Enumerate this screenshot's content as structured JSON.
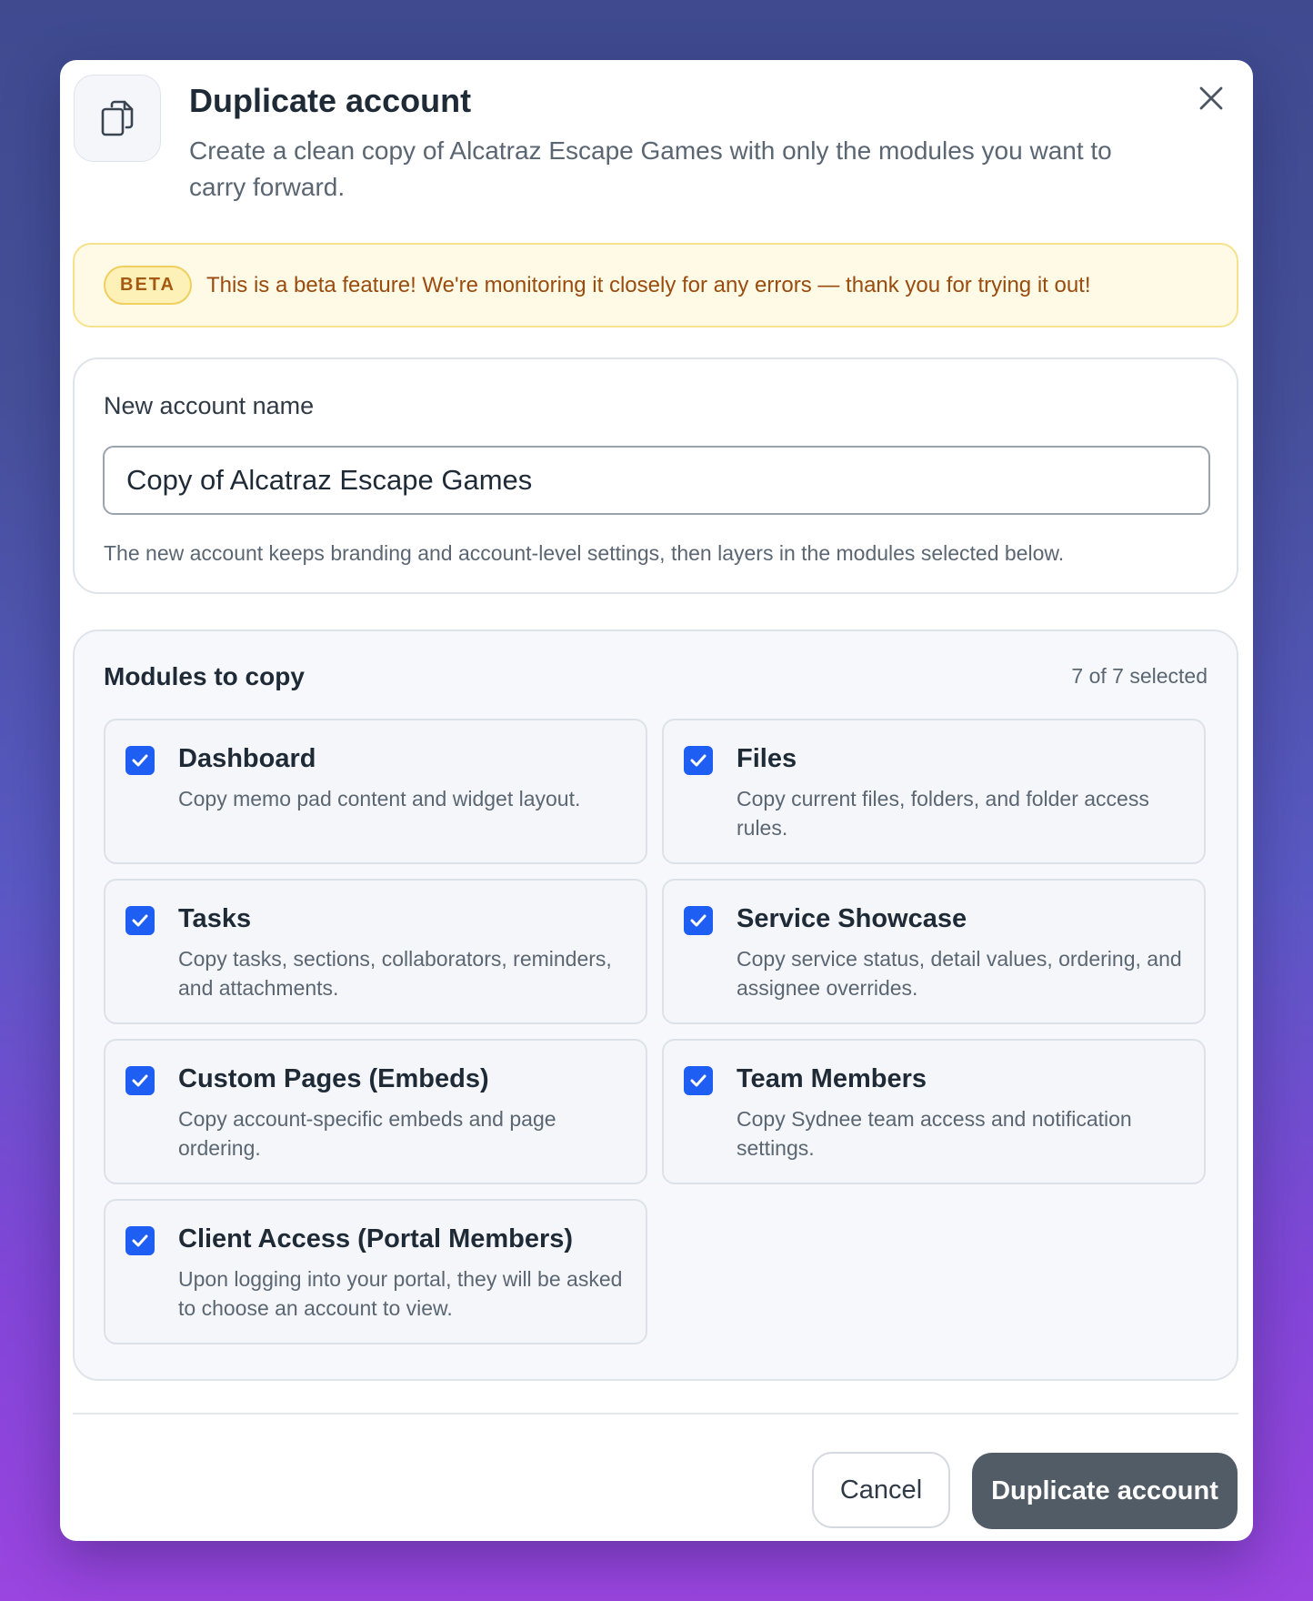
{
  "dialog": {
    "title": "Duplicate account",
    "subtitle": "Create a clean copy of Alcatraz Escape Games with only the modules you want to carry forward."
  },
  "beta": {
    "badge": "BETA",
    "message": "This is a beta feature! We're monitoring it closely for any errors — thank you for trying it out!"
  },
  "name_section": {
    "label": "New account name",
    "value": "Copy of Alcatraz Escape Games",
    "help": "The new account keeps branding and account-level settings, then layers in the modules selected below."
  },
  "modules": {
    "title": "Modules to copy",
    "count": "7 of 7 selected",
    "items": [
      {
        "title": "Dashboard",
        "desc": "Copy memo pad content and widget layout.",
        "checked": true
      },
      {
        "title": "Files",
        "desc": "Copy current files, folders, and folder access rules.",
        "checked": true
      },
      {
        "title": "Tasks",
        "desc": "Copy tasks, sections, collaborators, reminders, and attachments.",
        "checked": true
      },
      {
        "title": "Service Showcase",
        "desc": "Copy service status, detail values, ordering, and assignee overrides.",
        "checked": true
      },
      {
        "title": "Custom Pages (Embeds)",
        "desc": "Copy account-specific embeds and page ordering.",
        "checked": true
      },
      {
        "title": "Team Members",
        "desc": "Copy Sydnee team access and notification settings.",
        "checked": true
      },
      {
        "title": "Client Access (Portal Members)",
        "desc": "Upon logging into your portal, they will be asked to choose an account to view.",
        "checked": true
      }
    ]
  },
  "footer": {
    "cancel_label": "Cancel",
    "submit_label": "Duplicate account"
  },
  "colors": {
    "accent": "#1f5ef3",
    "primary_button": "#525c67",
    "beta_background": "#fefae6",
    "beta_text": "#9a4b0e"
  },
  "icons": {
    "header": "copy-icon",
    "close": "close-icon",
    "checkbox": "checkmark-icon"
  }
}
